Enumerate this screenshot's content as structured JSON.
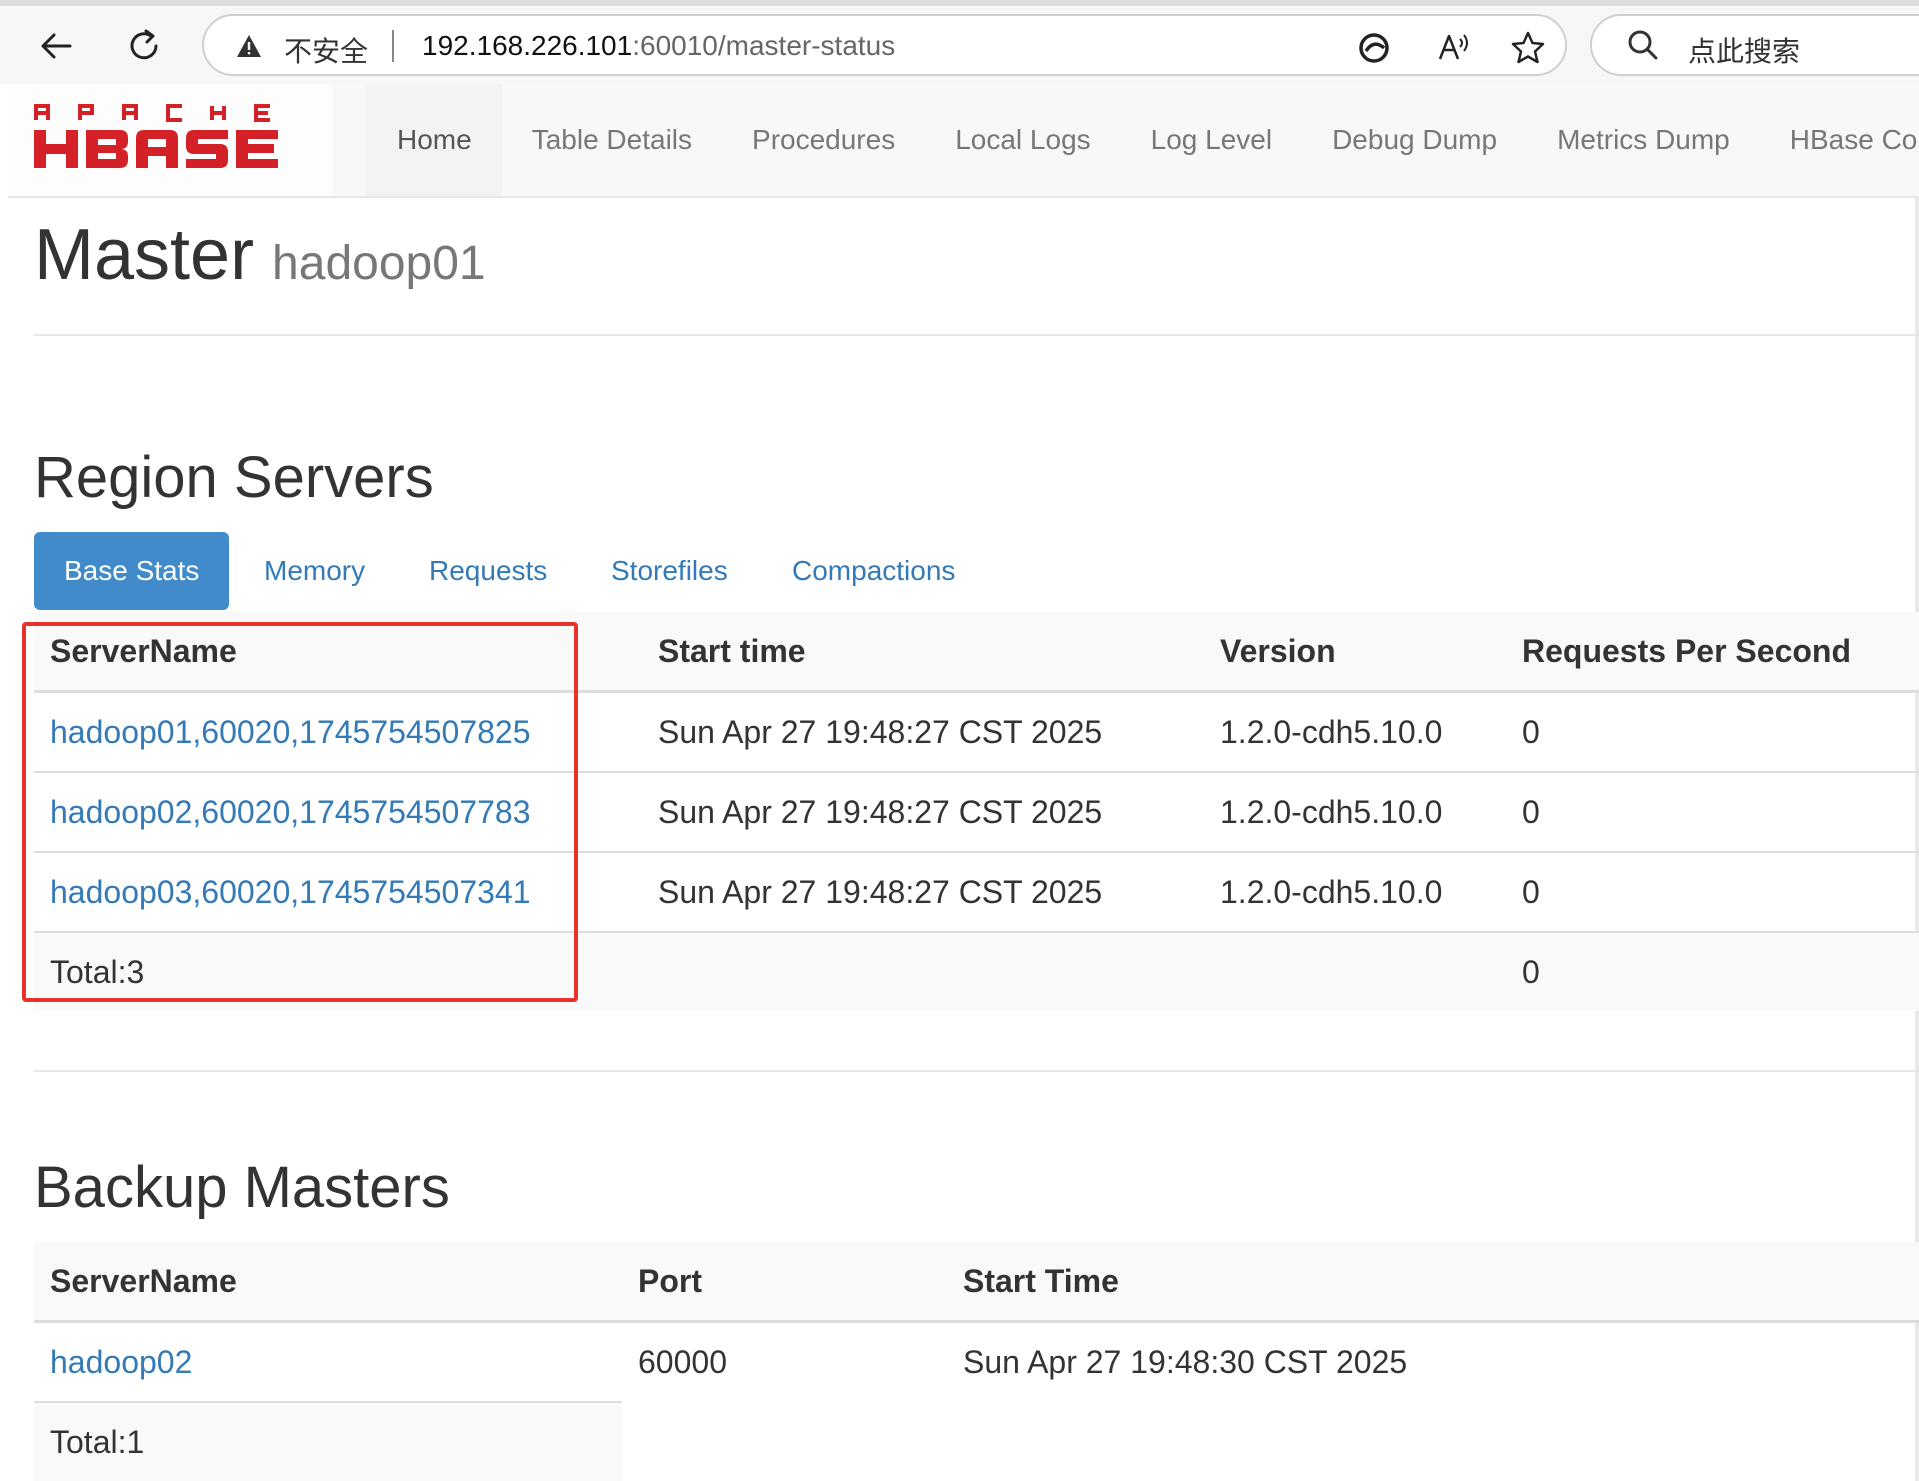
{
  "browser": {
    "security_label": "不安全",
    "url_host": "192.168.226.101",
    "url_rest": ":60010/master-status",
    "search_placeholder": "点此搜索"
  },
  "navbar": {
    "logo_text": "APACHE HBASE",
    "links": [
      "Home",
      "Table Details",
      "Procedures",
      "Local Logs",
      "Log Level",
      "Debug Dump",
      "Metrics Dump",
      "HBase Confi"
    ]
  },
  "page": {
    "title": "Master",
    "subtitle": "hadoop01"
  },
  "region_servers": {
    "title": "Region Servers",
    "tabs": [
      "Base Stats",
      "Memory",
      "Requests",
      "Storefiles",
      "Compactions"
    ],
    "active_tab": "Base Stats",
    "columns": [
      "ServerName",
      "Start time",
      "Version",
      "Requests Per Second"
    ],
    "rows": [
      {
        "server": "hadoop01,60020,1745754507825",
        "start": "Sun Apr 27 19:48:27 CST 2025",
        "version": "1.2.0-cdh5.10.0",
        "rps": "0"
      },
      {
        "server": "hadoop02,60020,1745754507783",
        "start": "Sun Apr 27 19:48:27 CST 2025",
        "version": "1.2.0-cdh5.10.0",
        "rps": "0"
      },
      {
        "server": "hadoop03,60020,1745754507341",
        "start": "Sun Apr 27 19:48:27 CST 2025",
        "version": "1.2.0-cdh5.10.0",
        "rps": "0"
      }
    ],
    "total_label": "Total:3",
    "total_rps": "0",
    "highlight_color": "#e8322c"
  },
  "backup_masters": {
    "title": "Backup Masters",
    "columns": [
      "ServerName",
      "Port",
      "Start Time"
    ],
    "rows": [
      {
        "server": "hadoop02",
        "port": "60000",
        "start": "Sun Apr 27 19:48:30 CST 2025"
      }
    ],
    "total_label": "Total:1"
  },
  "colors": {
    "link": "#337ab7",
    "active_tab": "#428bca",
    "logo_red": "#d42127"
  }
}
